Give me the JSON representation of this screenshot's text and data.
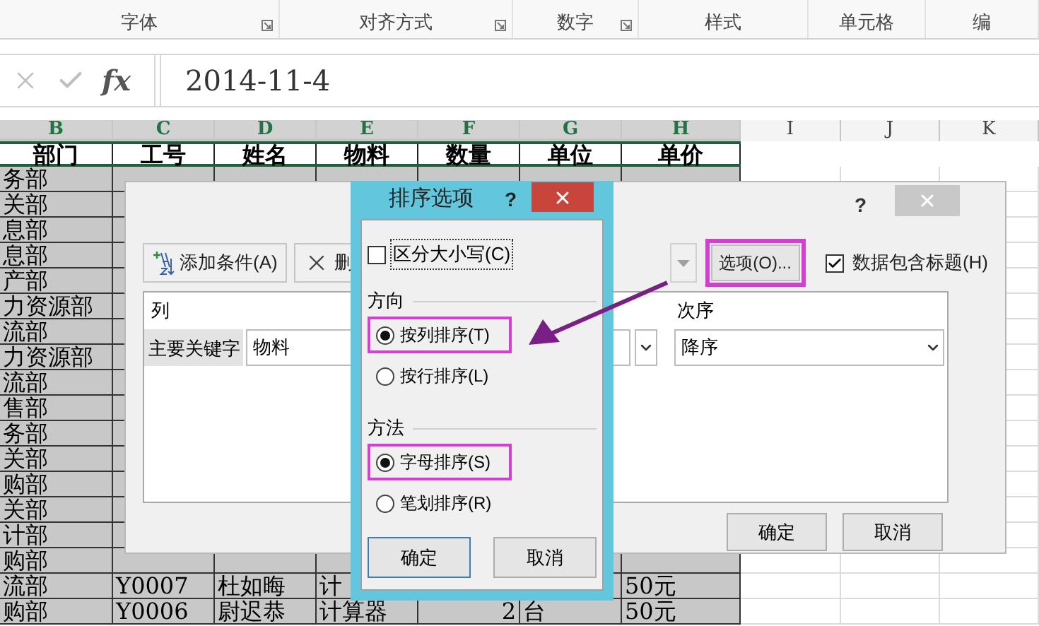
{
  "ribbon_groups": [
    {
      "label": "字体",
      "launcher": true
    },
    {
      "label": "对齐方式",
      "launcher": true
    },
    {
      "label": "数字",
      "launcher": true
    },
    {
      "label": "样式",
      "launcher": false
    },
    {
      "label": "单元格",
      "launcher": false
    },
    {
      "label": "编",
      "launcher": false
    }
  ],
  "formula_bar": {
    "function_label": "fx",
    "value": "2014-11-4"
  },
  "sheet": {
    "columns": [
      {
        "label": "B",
        "selected": true
      },
      {
        "label": "C",
        "selected": true
      },
      {
        "label": "D",
        "selected": true
      },
      {
        "label": "E",
        "selected": true
      },
      {
        "label": "F",
        "selected": true
      },
      {
        "label": "G",
        "selected": true
      },
      {
        "label": "H",
        "selected": true
      },
      {
        "label": "I",
        "selected": false
      },
      {
        "label": "J",
        "selected": false
      },
      {
        "label": "K",
        "selected": false
      }
    ],
    "header": [
      "部门",
      "工号",
      "姓名",
      "物料",
      "数量",
      "单位",
      "单价"
    ],
    "rows": [
      {
        "B": "务部"
      },
      {
        "B": "关部"
      },
      {
        "B": "息部"
      },
      {
        "B": "息部"
      },
      {
        "B": "产部"
      },
      {
        "B": "力资源部"
      },
      {
        "B": "流部"
      },
      {
        "B": "力资源部"
      },
      {
        "B": "流部"
      },
      {
        "B": "售部"
      },
      {
        "B": "务部"
      },
      {
        "B": "关部"
      },
      {
        "B": "购部"
      },
      {
        "B": "关部"
      },
      {
        "B": "计部"
      },
      {
        "B": "购部"
      },
      {
        "B": "流部",
        "C": "Y0007",
        "D": "杜如晦",
        "E": "计",
        "H": "50元"
      },
      {
        "B": "购部",
        "C": "Y0006",
        "D": "尉迟恭",
        "E": "计算器",
        "F": "2",
        "G": "台",
        "H": "50元"
      }
    ]
  },
  "sort_dialog": {
    "help": "?",
    "toolbar": [
      {
        "label": "添加条件(A)",
        "kind": "add"
      },
      {
        "label": "删",
        "kind": "delete"
      }
    ],
    "options_button": {
      "label": "选项(O)...",
      "highlighted": true
    },
    "header_checkbox": {
      "label": "数据包含标题(H)",
      "checked": true
    },
    "grid": {
      "columns": [
        "列",
        "次序"
      ],
      "rows": [
        {
          "label": "主要关键字",
          "column": "物料",
          "order": "降序"
        }
      ]
    },
    "buttons": [
      "确定",
      "取消"
    ]
  },
  "options_dialog": {
    "title": "排序选项",
    "help": "?",
    "case_checkbox": {
      "label": "区分大小写(C)",
      "checked": false
    },
    "sections": [
      {
        "title": "方向",
        "options": [
          {
            "label": "按列排序(T)",
            "selected": true
          },
          {
            "label": "按行排序(L)",
            "selected": false
          }
        ]
      },
      {
        "title": "方法",
        "options": [
          {
            "label": "字母排序(S)",
            "selected": true
          },
          {
            "label": "笔划排序(R)",
            "selected": false
          }
        ]
      }
    ],
    "buttons": [
      "确定",
      "取消"
    ]
  }
}
